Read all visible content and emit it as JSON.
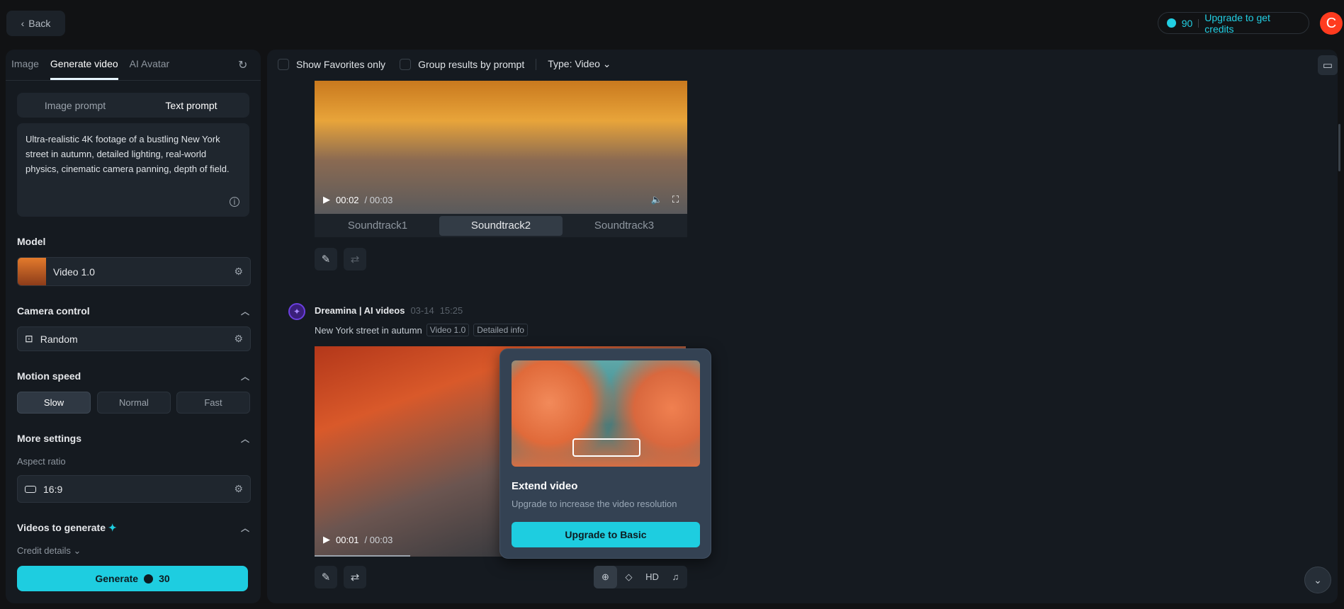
{
  "header": {
    "back_label": "Back",
    "credits": "90",
    "upgrade_label": "Upgrade to get credits",
    "avatar_letter": "C"
  },
  "sidebar": {
    "tabs": [
      "Image",
      "Generate video",
      "AI Avatar"
    ],
    "prompt_modes": [
      "Image prompt",
      "Text prompt"
    ],
    "prompt_text": "Ultra-realistic 4K footage of a bustling New York street in autumn, detailed lighting, real-world physics, cinematic camera panning, depth of field.",
    "model_label": "Model",
    "model_value": "Video 1.0",
    "camera_label": "Camera control",
    "camera_value": "Random",
    "motion_label": "Motion speed",
    "motion_options": [
      "Slow",
      "Normal",
      "Fast"
    ],
    "motion_selected": "Slow",
    "more_label": "More settings",
    "aspect_label": "Aspect ratio",
    "aspect_value": "16:9",
    "videos_label": "Videos to generate",
    "credit_details": "Credit details",
    "generate_label": "Generate",
    "generate_cost": "30"
  },
  "toolbar": {
    "favorites": "Show Favorites only",
    "group": "Group results by prompt",
    "type": "Type: Video"
  },
  "result1": {
    "time": "00:02",
    "duration": "/ 00:03",
    "soundtracks": [
      "Soundtrack1",
      "Soundtrack2",
      "Soundtrack3"
    ],
    "selected": "Soundtrack2"
  },
  "result2": {
    "author": "Dreamina | AI videos",
    "date": "03-14",
    "clock": "15:25",
    "prompt": "New York street in autumn",
    "tag_model": "Video 1.0",
    "tag_info": "Detailed info",
    "time": "00:01",
    "duration": "/ 00:03",
    "hd": "HD"
  },
  "popup": {
    "title": "Extend video",
    "desc": "Upgrade to increase the video resolution",
    "button": "Upgrade to Basic"
  },
  "colors": {
    "accent": "#1ecde0",
    "avatar": "#ff3b1f",
    "bg": "#111214",
    "panel": "#151a20"
  }
}
